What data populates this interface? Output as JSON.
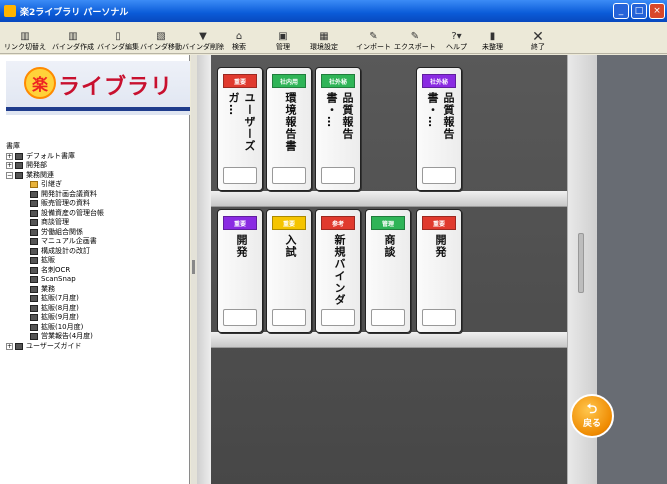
{
  "window": {
    "title": "楽2ライブラリ パーソナル",
    "controls": [
      "_",
      "□",
      "×"
    ]
  },
  "toolbar": [
    {
      "label": "リンク切替え",
      "icon": "link-switch-icon"
    },
    {
      "label": "バインダ作成",
      "icon": "binder-create-icon"
    },
    {
      "label": "バインダ編集",
      "icon": "binder-edit-icon"
    },
    {
      "label": "バインダ移動",
      "icon": "binder-move-icon"
    },
    {
      "label": "バインダ削除",
      "icon": "binder-delete-icon"
    },
    {
      "label": "検索",
      "icon": "search-icon"
    },
    {
      "label": "管理",
      "icon": "manage-icon"
    },
    {
      "label": "環境設定",
      "icon": "settings-icon"
    },
    {
      "label": "インポート",
      "icon": "import-icon"
    },
    {
      "label": "エクスポート",
      "icon": "export-icon"
    },
    {
      "label": "ヘルプ",
      "icon": "help-icon"
    },
    {
      "label": "未整理",
      "icon": "unsorted-icon"
    },
    {
      "label": "終了",
      "icon": "close-icon"
    }
  ],
  "logo": {
    "mark": "楽",
    "name": "ライブラリ"
  },
  "tree": {
    "root": "書庫",
    "nodes": [
      {
        "label": "デフォルト書庫",
        "expander": "+",
        "level": 1
      },
      {
        "label": "開発部",
        "expander": "+",
        "level": 1
      },
      {
        "label": "業務関連",
        "expander": "−",
        "level": 1
      },
      {
        "label": "引継ぎ",
        "level": 2,
        "selected": true
      },
      {
        "label": "開発計画会議資料",
        "level": 2
      },
      {
        "label": "販売管理の資料",
        "level": 2
      },
      {
        "label": "設備資産の管理台帳",
        "level": 2
      },
      {
        "label": "商談管理",
        "level": 2
      },
      {
        "label": "労働組合関係",
        "level": 2
      },
      {
        "label": "マニュアル企画書",
        "level": 2
      },
      {
        "label": "構成設計の改訂",
        "level": 2
      },
      {
        "label": "拡販",
        "level": 2
      },
      {
        "label": "名刺OCR",
        "level": 2
      },
      {
        "label": "ScanSnap",
        "level": 2
      },
      {
        "label": "業務",
        "level": 2
      },
      {
        "label": "拡販(7月度)",
        "level": 2
      },
      {
        "label": "拡販(8月度)",
        "level": 2
      },
      {
        "label": "拡販(9月度)",
        "level": 2
      },
      {
        "label": "拡販(10月度)",
        "level": 2
      },
      {
        "label": "営業報告(4月度)",
        "level": 2
      },
      {
        "label": "ユーザーズガイド",
        "expander": "+",
        "level": 1
      }
    ]
  },
  "shelves": {
    "top": [
      {
        "tag": "重要",
        "tag_color": "#e03a2e",
        "title": "ユーザーズガ…"
      },
      {
        "tag": "社内用",
        "tag_color": "#2fb457",
        "title": "環境報告書"
      },
      {
        "tag": "社外秘",
        "tag_color": "#2fb457",
        "title": "品質報告書・…"
      },
      {
        "tag": "社外秘",
        "tag_color": "#8a2be2",
        "title": "品質報告書・…"
      }
    ],
    "bottom": [
      {
        "tag": "重要",
        "tag_color": "#8a2be2",
        "title": "開発"
      },
      {
        "tag": "重要",
        "tag_color": "#f5c400",
        "title": "入試"
      },
      {
        "tag": "参考",
        "tag_color": "#e03a2e",
        "title": "新規バインダ"
      },
      {
        "tag": "管理",
        "tag_color": "#2fb457",
        "title": "商談"
      },
      {
        "tag": "重要",
        "tag_color": "#e03a2e",
        "title": "開発"
      }
    ]
  },
  "back_button": {
    "label": "戻る",
    "icon": "back-arrow-icon"
  }
}
